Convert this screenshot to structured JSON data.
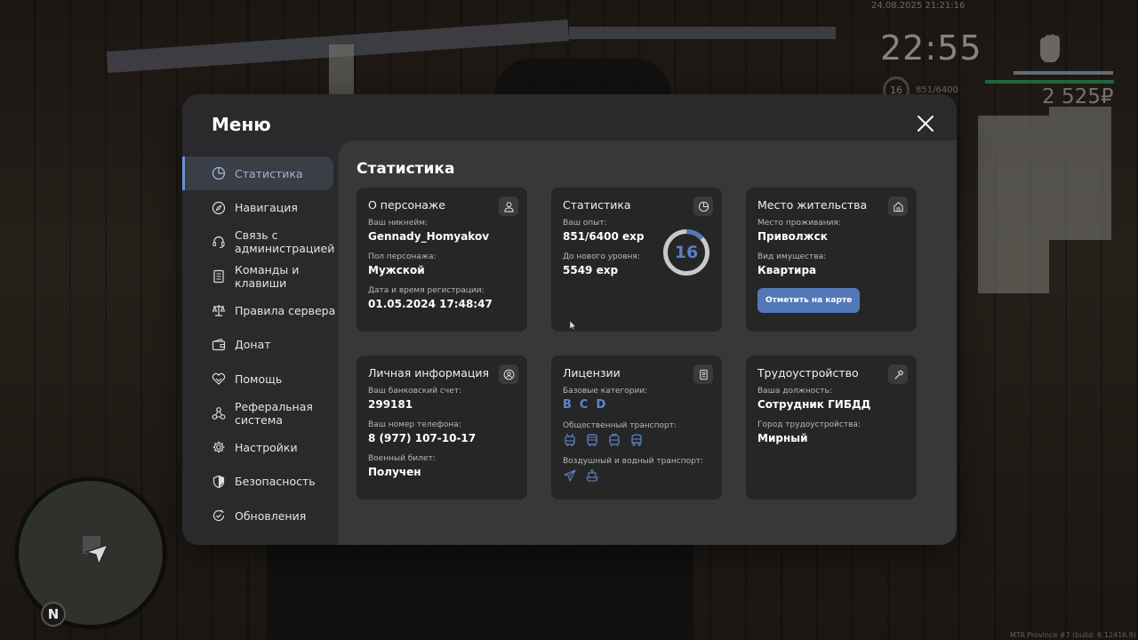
{
  "hud": {
    "datetime": "24.08.2025 21:21:16",
    "clock": "22:55",
    "level": "16",
    "exp": "851/6400",
    "money": "2 525₽",
    "compass": "N",
    "build_info": "MTA Province #7 (build: 6.12416.9)"
  },
  "menu": {
    "title": "Меню",
    "sidebar": [
      {
        "label": "Статистика",
        "icon": "pie-chart-icon",
        "active": true
      },
      {
        "label": "Навигация",
        "icon": "compass-icon"
      },
      {
        "label": "Связь с администрацией",
        "icon": "headset-icon"
      },
      {
        "label": "Команды и клавиши",
        "icon": "document-icon"
      },
      {
        "label": "Правила сервера",
        "icon": "scales-icon"
      },
      {
        "label": "Донат",
        "icon": "wallet-icon"
      },
      {
        "label": "Помощь",
        "icon": "handshake-heart-icon"
      },
      {
        "label": "Реферальная система",
        "icon": "network-icon"
      },
      {
        "label": "Настройки",
        "icon": "gear-icon"
      },
      {
        "label": "Безопасность",
        "icon": "shield-icon"
      },
      {
        "label": "Обновления",
        "icon": "refresh-check-icon"
      }
    ],
    "content_title": "Статистика"
  },
  "cards": {
    "character": {
      "title": "О персонаже",
      "nickname_label": "Ваш никнейм:",
      "nickname": "Gennady_Homyakov",
      "gender_label": "Пол персонажа:",
      "gender": "Мужской",
      "reg_label": "Дата и время регистрации:",
      "reg_date": "01.05.2024 17:48:47"
    },
    "stats": {
      "title": "Статистика",
      "exp_label": "Ваш опыт:",
      "exp_value": "851/6400 exp",
      "next_label": "До нового уровня:",
      "next_value": "5549 exp",
      "level": "16",
      "progress": 0.133
    },
    "residence": {
      "title": "Место жительства",
      "place_label": "Место проживания:",
      "place": "Приволжск",
      "type_label": "Вид имущества:",
      "type": "Квартира",
      "button": "Отметить на карте"
    },
    "personal": {
      "title": "Личная информация",
      "bank_label": "Ваш банковский счет:",
      "bank": "299181",
      "phone_label": "Ваш номер телефона:",
      "phone": "8 (977) 107-10-17",
      "military_label": "Военный билет:",
      "military": "Получен"
    },
    "licenses": {
      "title": "Лицензии",
      "base_label": "Базовые категории:",
      "categories": [
        "B",
        "C",
        "D"
      ],
      "public_label": "Общественный транспорт:",
      "public_icons": [
        "trolleybus-icon",
        "bus-icon",
        "tram-icon",
        "minibus-icon"
      ],
      "air_label": "Воздушный и водный транспорт:",
      "air_icons": [
        "airplane-icon",
        "ship-icon"
      ]
    },
    "job": {
      "title": "Трудоустройство",
      "position_label": "Ваша должность:",
      "position": "Сотрудник ГИБДД",
      "city_label": "Город трудоустройства:",
      "city": "Мирный"
    }
  },
  "colors": {
    "accent": "#5378b8",
    "accent_text": "#5f86cc",
    "panel": "#2a2a2c",
    "card": "#262627"
  }
}
